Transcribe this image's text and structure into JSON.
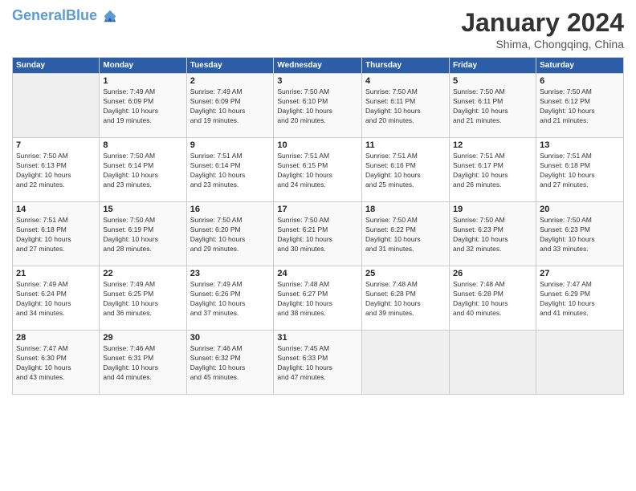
{
  "header": {
    "logo_line1": "General",
    "logo_line2": "Blue",
    "month": "January 2024",
    "location": "Shima, Chongqing, China"
  },
  "days_of_week": [
    "Sunday",
    "Monday",
    "Tuesday",
    "Wednesday",
    "Thursday",
    "Friday",
    "Saturday"
  ],
  "weeks": [
    [
      {
        "day": "",
        "info": ""
      },
      {
        "day": "1",
        "info": "Sunrise: 7:49 AM\nSunset: 6:09 PM\nDaylight: 10 hours\nand 19 minutes."
      },
      {
        "day": "2",
        "info": "Sunrise: 7:49 AM\nSunset: 6:09 PM\nDaylight: 10 hours\nand 19 minutes."
      },
      {
        "day": "3",
        "info": "Sunrise: 7:50 AM\nSunset: 6:10 PM\nDaylight: 10 hours\nand 20 minutes."
      },
      {
        "day": "4",
        "info": "Sunrise: 7:50 AM\nSunset: 6:11 PM\nDaylight: 10 hours\nand 20 minutes."
      },
      {
        "day": "5",
        "info": "Sunrise: 7:50 AM\nSunset: 6:11 PM\nDaylight: 10 hours\nand 21 minutes."
      },
      {
        "day": "6",
        "info": "Sunrise: 7:50 AM\nSunset: 6:12 PM\nDaylight: 10 hours\nand 21 minutes."
      }
    ],
    [
      {
        "day": "7",
        "info": "Sunrise: 7:50 AM\nSunset: 6:13 PM\nDaylight: 10 hours\nand 22 minutes."
      },
      {
        "day": "8",
        "info": "Sunrise: 7:50 AM\nSunset: 6:14 PM\nDaylight: 10 hours\nand 23 minutes."
      },
      {
        "day": "9",
        "info": "Sunrise: 7:51 AM\nSunset: 6:14 PM\nDaylight: 10 hours\nand 23 minutes."
      },
      {
        "day": "10",
        "info": "Sunrise: 7:51 AM\nSunset: 6:15 PM\nDaylight: 10 hours\nand 24 minutes."
      },
      {
        "day": "11",
        "info": "Sunrise: 7:51 AM\nSunset: 6:16 PM\nDaylight: 10 hours\nand 25 minutes."
      },
      {
        "day": "12",
        "info": "Sunrise: 7:51 AM\nSunset: 6:17 PM\nDaylight: 10 hours\nand 26 minutes."
      },
      {
        "day": "13",
        "info": "Sunrise: 7:51 AM\nSunset: 6:18 PM\nDaylight: 10 hours\nand 27 minutes."
      }
    ],
    [
      {
        "day": "14",
        "info": "Sunrise: 7:51 AM\nSunset: 6:18 PM\nDaylight: 10 hours\nand 27 minutes."
      },
      {
        "day": "15",
        "info": "Sunrise: 7:50 AM\nSunset: 6:19 PM\nDaylight: 10 hours\nand 28 minutes."
      },
      {
        "day": "16",
        "info": "Sunrise: 7:50 AM\nSunset: 6:20 PM\nDaylight: 10 hours\nand 29 minutes."
      },
      {
        "day": "17",
        "info": "Sunrise: 7:50 AM\nSunset: 6:21 PM\nDaylight: 10 hours\nand 30 minutes."
      },
      {
        "day": "18",
        "info": "Sunrise: 7:50 AM\nSunset: 6:22 PM\nDaylight: 10 hours\nand 31 minutes."
      },
      {
        "day": "19",
        "info": "Sunrise: 7:50 AM\nSunset: 6:23 PM\nDaylight: 10 hours\nand 32 minutes."
      },
      {
        "day": "20",
        "info": "Sunrise: 7:50 AM\nSunset: 6:23 PM\nDaylight: 10 hours\nand 33 minutes."
      }
    ],
    [
      {
        "day": "21",
        "info": "Sunrise: 7:49 AM\nSunset: 6:24 PM\nDaylight: 10 hours\nand 34 minutes."
      },
      {
        "day": "22",
        "info": "Sunrise: 7:49 AM\nSunset: 6:25 PM\nDaylight: 10 hours\nand 36 minutes."
      },
      {
        "day": "23",
        "info": "Sunrise: 7:49 AM\nSunset: 6:26 PM\nDaylight: 10 hours\nand 37 minutes."
      },
      {
        "day": "24",
        "info": "Sunrise: 7:48 AM\nSunset: 6:27 PM\nDaylight: 10 hours\nand 38 minutes."
      },
      {
        "day": "25",
        "info": "Sunrise: 7:48 AM\nSunset: 6:28 PM\nDaylight: 10 hours\nand 39 minutes."
      },
      {
        "day": "26",
        "info": "Sunrise: 7:48 AM\nSunset: 6:28 PM\nDaylight: 10 hours\nand 40 minutes."
      },
      {
        "day": "27",
        "info": "Sunrise: 7:47 AM\nSunset: 6:29 PM\nDaylight: 10 hours\nand 41 minutes."
      }
    ],
    [
      {
        "day": "28",
        "info": "Sunrise: 7:47 AM\nSunset: 6:30 PM\nDaylight: 10 hours\nand 43 minutes."
      },
      {
        "day": "29",
        "info": "Sunrise: 7:46 AM\nSunset: 6:31 PM\nDaylight: 10 hours\nand 44 minutes."
      },
      {
        "day": "30",
        "info": "Sunrise: 7:46 AM\nSunset: 6:32 PM\nDaylight: 10 hours\nand 45 minutes."
      },
      {
        "day": "31",
        "info": "Sunrise: 7:45 AM\nSunset: 6:33 PM\nDaylight: 10 hours\nand 47 minutes."
      },
      {
        "day": "",
        "info": ""
      },
      {
        "day": "",
        "info": ""
      },
      {
        "day": "",
        "info": ""
      }
    ]
  ]
}
